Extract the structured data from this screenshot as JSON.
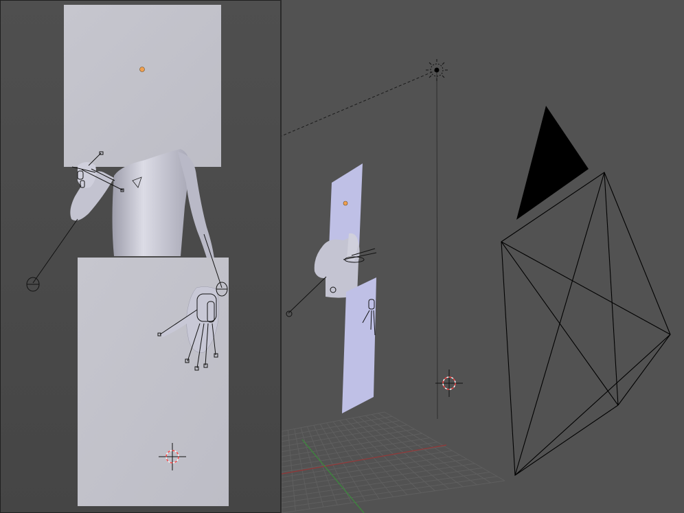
{
  "viewports": {
    "left": {
      "name": "",
      "view": "front"
    },
    "right": {
      "name": "",
      "view": "perspective"
    }
  },
  "colors": {
    "background": "#4d4d4d",
    "plane": "#c4c4cc",
    "plane_blue": "#bfc0e6",
    "mannequin": "#c9c9d6",
    "wire": "#000000",
    "origin_dot": "#f0a050",
    "cursor_red": "#ff4040",
    "grid": "#5e5e5e",
    "x_axis": "#8c3a3a",
    "y_axis": "#3a8c3a"
  },
  "icons": [
    "3d-cursor-icon",
    "lamp-icon",
    "camera-icon",
    "origin-dot-icon",
    "bone-icon"
  ]
}
